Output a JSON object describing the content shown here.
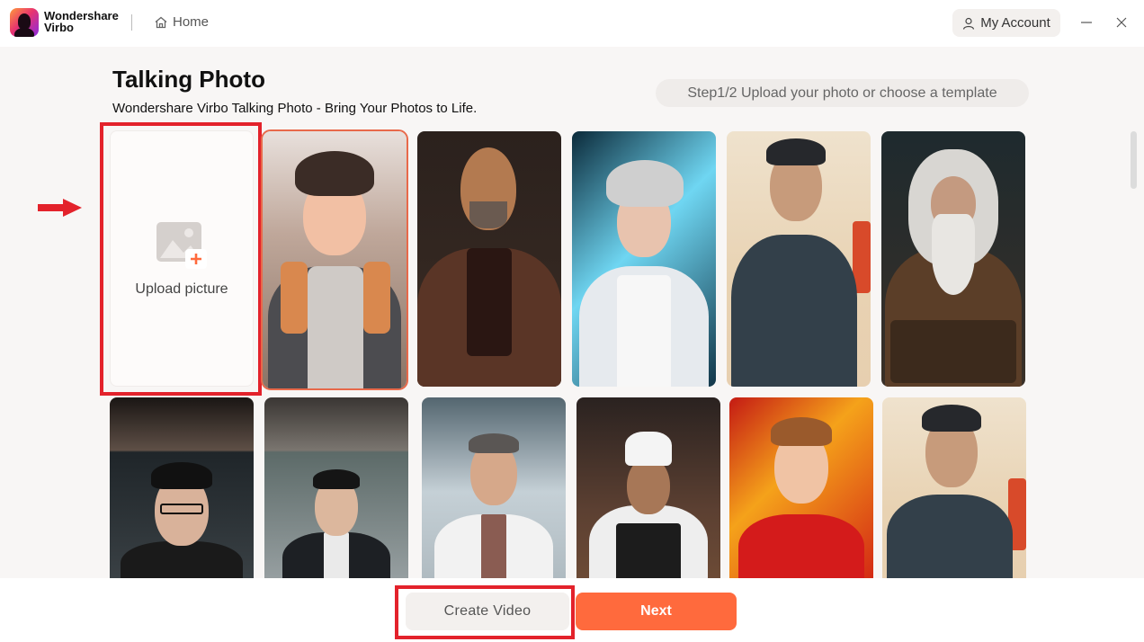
{
  "app": {
    "brand_line1": "Wondershare",
    "brand_line2": "Virbo",
    "home_label": "Home",
    "account_label": "My Account"
  },
  "header": {
    "title": "Talking Photo",
    "subtitle": "Wondershare Virbo Talking Photo - Bring Your Photos to Life.",
    "step": "Step1/2 Upload your photo or choose a template"
  },
  "upload": {
    "label": "Upload picture"
  },
  "templates": [
    {
      "description": "Cartoon young man with backpack",
      "selected": true
    },
    {
      "description": "Bald monk in brown robes",
      "selected": false
    },
    {
      "description": "Young man in white hoodie, neon background",
      "selected": false
    },
    {
      "description": "Ink painting of man in dark coat",
      "selected": false
    },
    {
      "description": "Old wizard with white beard reading book",
      "selected": false
    },
    {
      "description": "Young man with glasses in black hoodie",
      "selected": false
    },
    {
      "description": "Man in black suit and tie",
      "selected": false
    },
    {
      "description": "Doctor in white coat with stethoscope",
      "selected": false
    },
    {
      "description": "Chef in white hat and apron",
      "selected": false
    },
    {
      "description": "Smiling young man with red scarf",
      "selected": false
    },
    {
      "description": "Ink painting of man in dark coat",
      "selected": false
    }
  ],
  "footer": {
    "create_video_label": "Create Video",
    "next_label": "Next"
  },
  "colors": {
    "accent": "#ff6a3d",
    "highlight": "#e3222b",
    "selected_border": "#e8694a"
  }
}
